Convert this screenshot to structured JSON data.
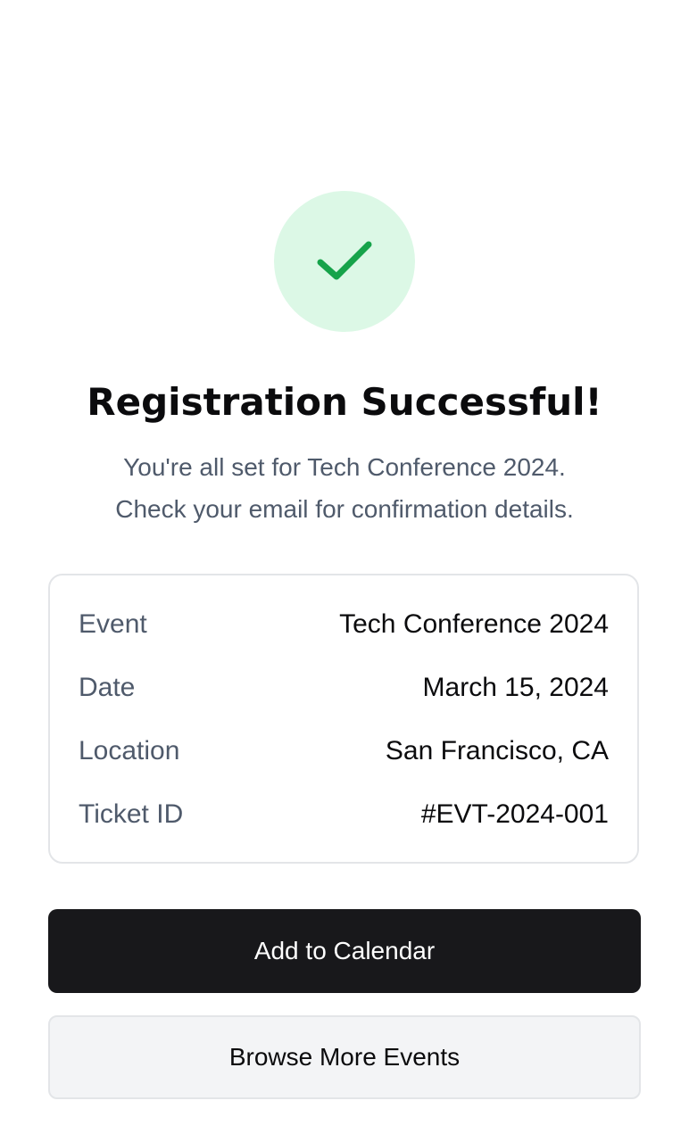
{
  "success_icon": {
    "icon": "checkmark-icon",
    "circle_color": "#dcf8e6",
    "check_color": "#16a34a"
  },
  "header": {
    "title": "Registration Successful!",
    "subtitle_line1": "You're all set for Tech Conference 2024.",
    "subtitle_line2": "Check your email for confirmation details."
  },
  "details": {
    "rows": [
      {
        "label": "Event",
        "value": "Tech Conference 2024"
      },
      {
        "label": "Date",
        "value": "March 15, 2024"
      },
      {
        "label": "Location",
        "value": "San Francisco, CA"
      },
      {
        "label": "Ticket ID",
        "value": "#EVT-2024-001"
      }
    ]
  },
  "actions": {
    "primary_label": "Add to Calendar",
    "secondary_label": "Browse More Events"
  },
  "colors": {
    "primary_button_bg": "#18181b",
    "secondary_button_bg": "#f3f4f6",
    "muted_text": "#4f5a6b"
  }
}
